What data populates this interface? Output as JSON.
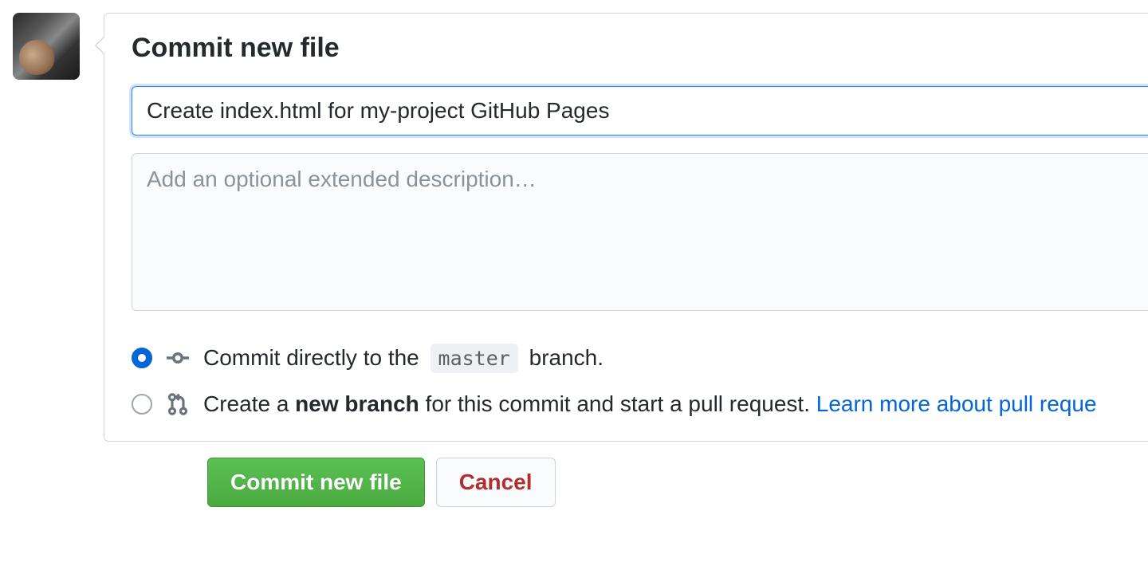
{
  "panel": {
    "title": "Commit new file",
    "summary_value": "Create index.html for my-project GitHub Pages",
    "description_placeholder": "Add an optional extended description…"
  },
  "options": {
    "direct": {
      "text_before": "Commit directly to the ",
      "branch_name": "master",
      "text_after": " branch."
    },
    "new_branch": {
      "text_before": "Create a ",
      "bold_text": "new branch",
      "text_after": " for this commit and start a pull request. ",
      "link_text": "Learn more about pull reque"
    }
  },
  "actions": {
    "commit_label": "Commit new file",
    "cancel_label": "Cancel"
  }
}
